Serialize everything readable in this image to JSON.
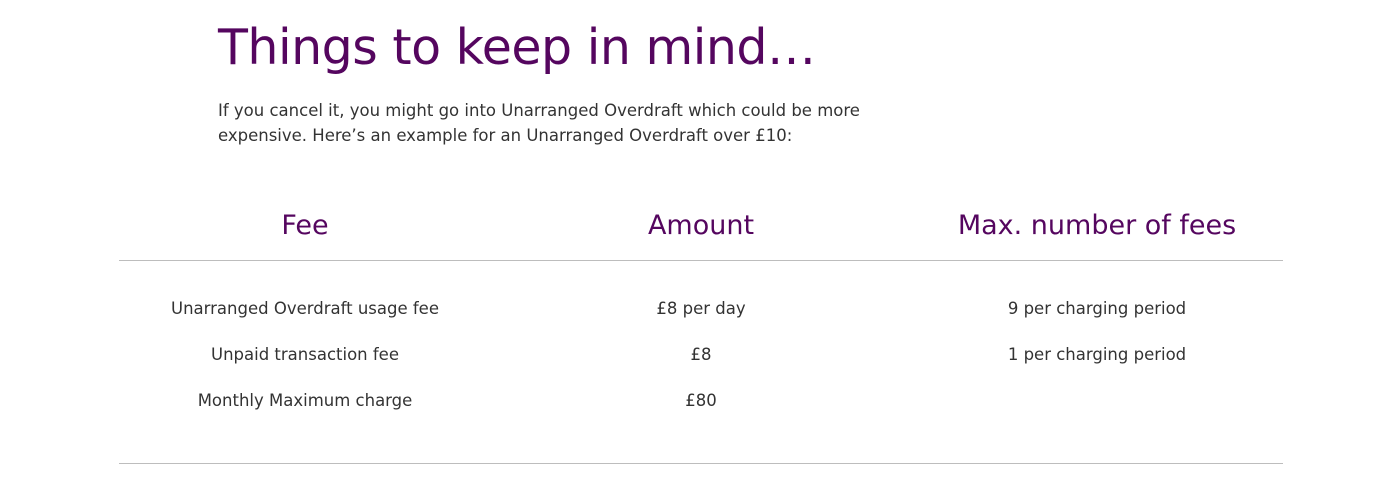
{
  "heading": "Things to keep in mind…",
  "intro_text": "If you cancel it, you might go into Unarranged Overdraft which could be more expensive. Here’s an example for an Unarranged Overdraft over £10:",
  "table": {
    "headers": [
      "Fee",
      "Amount",
      "Max. number of fees"
    ],
    "rows": [
      {
        "fee": "Unarranged Overdraft usage fee",
        "amount": "£8 per day",
        "max": "9 per charging period"
      },
      {
        "fee": "Unpaid transaction fee",
        "amount": "£8",
        "max": "1 per charging period"
      },
      {
        "fee": "Monthly Maximum charge",
        "amount": "£80",
        "max": ""
      }
    ]
  },
  "colors": {
    "heading": "#55065f",
    "body_text": "#333333",
    "divider": "#bdbdbd"
  }
}
